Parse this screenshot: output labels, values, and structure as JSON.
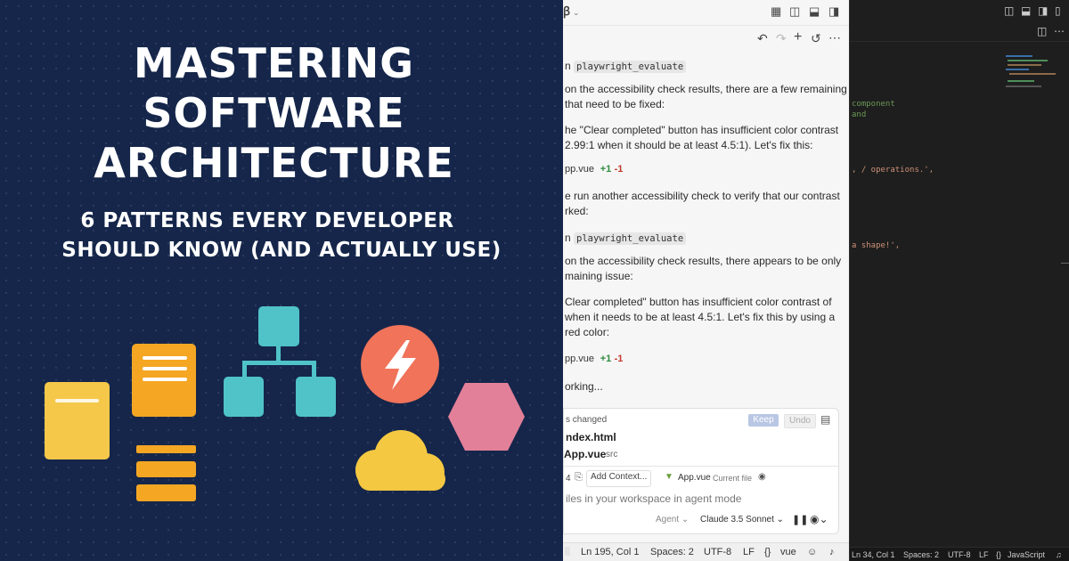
{
  "promo": {
    "title_lines": [
      "MASTERING",
      "SOFTWARE",
      "ARCHITECTURE"
    ],
    "subtitle_lines": [
      "6 PATTERNS EVERY DEVELOPER",
      "SHOULD KNOW (AND ACTUALLY USE)"
    ],
    "colors": {
      "background": "#15264a",
      "yellow": "#f5c84a",
      "orange": "#f5a623",
      "teal": "#4fc3c8",
      "red": "#f0735a",
      "pink": "#e2809a",
      "cloud": "#f5c842"
    }
  },
  "chat": {
    "lines": {
      "ran1_prefix": "n",
      "ran1_tool": "playwright_evaluate",
      "msg1_a": " on the accessibility check results, there are a few remaining",
      "msg1_b": " that need to be fixed:",
      "msg2_a": "he \"Clear completed\" button has insufficient color contrast",
      "msg2_b": "2.99:1 when it should be at least 4.5:1). Let's fix this:",
      "file1": "pp.vue",
      "file1_plus": "+1",
      "file1_minus": "-1",
      "msg3_a": "e run another accessibility check to verify that our contrast",
      "msg3_b": "rked:",
      "ran2_prefix": "n",
      "ran2_tool": "playwright_evaluate",
      "msg4_a": " on the accessibility check results, there appears to be only",
      "msg4_b": "maining issue:",
      "msg5_a": "Clear completed\" button has insufficient color contrast of",
      "msg5_b": " when it needs to be at least 4.5:1. Let's fix this by using a",
      "msg5_c": " red color:",
      "file2": "pp.vue",
      "file2_plus": "+1",
      "file2_minus": "-1",
      "working": "orking..."
    },
    "changes": {
      "header": "s changed",
      "keep": "Keep",
      "undo": "Undo",
      "files": [
        {
          "name": "ndex.html",
          "dir": ""
        },
        {
          "name": "App.vue",
          "dir": "src"
        }
      ]
    },
    "input": {
      "count": "4",
      "add_context": "Add Context...",
      "current_file_name": "App.vue",
      "current_file_label": "Current file",
      "placeholder": "iles in your workspace in agent mode",
      "mode": "Agent",
      "model": "Claude 3.5 Sonnet"
    },
    "status": {
      "position": "Ln 195, Col 1",
      "spaces": "Spaces: 2",
      "encoding": "UTF-8",
      "eol": "LF",
      "language": "vue"
    }
  },
  "editor": {
    "code": [
      {
        "text": "component",
        "color": "#6a9955"
      },
      {
        "text": "and",
        "color": "#6a9955"
      },
      {
        "text": ", / operations.',",
        "color": "#ce9178"
      },
      {
        "text": "a shape!',",
        "color": "#ce9178"
      }
    ],
    "status": {
      "position": "Ln 34, Col 1",
      "spaces": "Spaces: 2",
      "encoding": "UTF-8",
      "eol": "LF",
      "language": "JavaScript"
    }
  }
}
